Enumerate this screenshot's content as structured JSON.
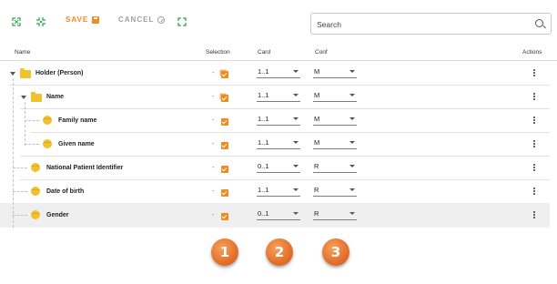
{
  "toolbar": {
    "expand_icon": "expand-all-icon",
    "collapse_icon": "collapse-all-icon",
    "save_label": "SAVE",
    "cancel_label": "CANCEL",
    "fullscreen_icon": "fullscreen-icon",
    "colors": {
      "save": "#f28a1c",
      "cancel": "#a0a0a0",
      "icons": "#2aa44a"
    }
  },
  "search": {
    "value": "Search"
  },
  "columns": {
    "name": "Name",
    "selection": "Selection",
    "card": "Card",
    "conf": "Conf",
    "actions": "Actions"
  },
  "rows": [
    {
      "label": "Holder (Person)",
      "dash": "-",
      "card": "1..1",
      "conf": "M"
    },
    {
      "label": "Name",
      "dash": "-",
      "card": "1..1",
      "conf": "M"
    },
    {
      "label": "Family name",
      "dash": "-",
      "card": "1..1",
      "conf": "M"
    },
    {
      "label": "Given name",
      "dash": "-",
      "card": "1..1",
      "conf": "M"
    },
    {
      "label": "National Patient Identifier",
      "dash": "-",
      "card": "0..1",
      "conf": "R"
    },
    {
      "label": "Date of birth",
      "dash": "-",
      "card": "1..1",
      "conf": "R"
    },
    {
      "label": "Gender",
      "dash": "-",
      "card": "0..1",
      "conf": "R"
    }
  ],
  "badges": [
    "1",
    "2",
    "3"
  ]
}
